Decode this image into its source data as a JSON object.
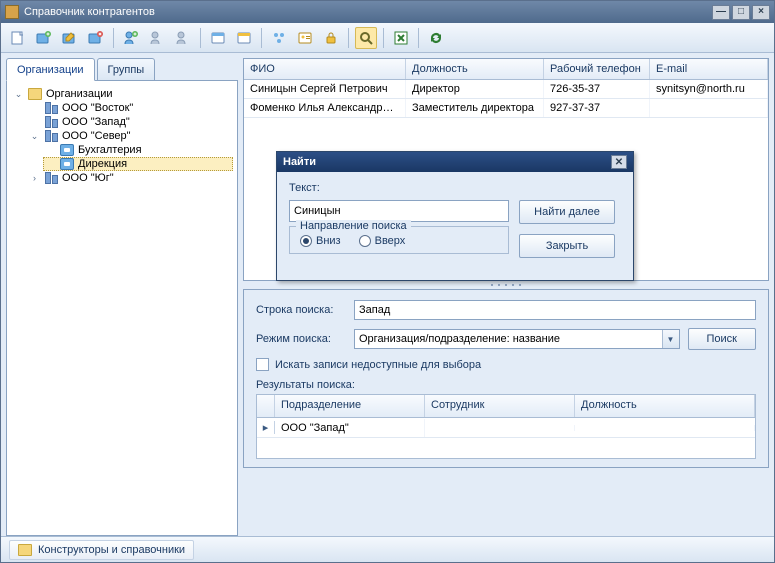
{
  "window": {
    "title": "Справочник контрагентов"
  },
  "tabs": {
    "orgs": "Организации",
    "groups": "Группы"
  },
  "tree": {
    "root": "Организации",
    "n0": "ООО \"Восток\"",
    "n1": "ООО \"Запад\"",
    "n2": "ООО \"Север\"",
    "n2_0": "Бухгалтерия",
    "n2_1": "Дирекция",
    "n3": "ООО \"Юг\""
  },
  "grid": {
    "cols": {
      "fio": "ФИО",
      "pos": "Должность",
      "phone": "Рабочий телефон",
      "email": "E-mail"
    },
    "rows": [
      {
        "fio": "Синицын Сергей Петрович",
        "pos": "Директор",
        "phone": "726-35-37",
        "email": "synitsyn@north.ru"
      },
      {
        "fio": "Фоменко Илья Александрович",
        "pos": "Заместитель директора",
        "phone": "927-37-37",
        "email": ""
      }
    ]
  },
  "dialog": {
    "title": "Найти",
    "text_label": "Текст:",
    "text_value": "Синицын",
    "dir_legend": "Направление поиска",
    "down": "Вниз",
    "up": "Вверх",
    "find_next": "Найти далее",
    "close": "Закрыть"
  },
  "search": {
    "row_label": "Строка поиска:",
    "row_value": "Запад",
    "mode_label": "Режим поиска:",
    "mode_value": "Организация/подразделение: название",
    "btn": "Поиск",
    "chk": "Искать записи недоступные для выбора",
    "results_label": "Результаты поиска:",
    "cols": {
      "dept": "Подразделение",
      "emp": "Сотрудник",
      "pos": "Должность"
    },
    "result0": "ООО \"Запад\""
  },
  "status": {
    "link": "Конструкторы и справочники"
  }
}
